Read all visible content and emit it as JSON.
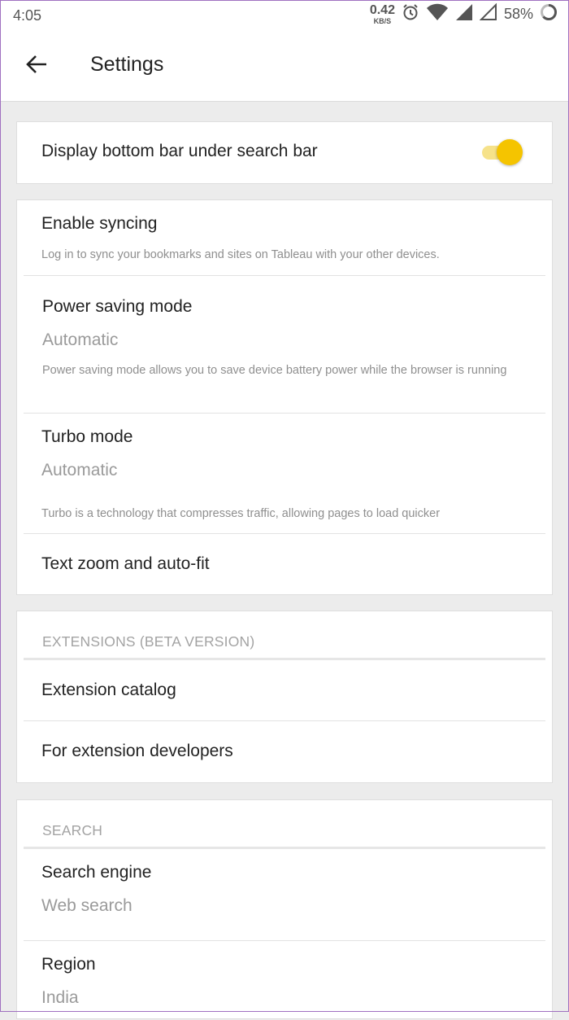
{
  "status_bar": {
    "time": "4:05",
    "speed_value": "0.42",
    "speed_unit": "KB/S",
    "battery": "58%"
  },
  "app_bar": {
    "title": "Settings"
  },
  "display_card": {
    "bottom_bar_label": "Display bottom bar under search bar",
    "bottom_bar_enabled": true
  },
  "general_card": {
    "syncing": {
      "title": "Enable syncing",
      "desc": "Log in to sync your bookmarks and sites on Tableau with your other devices."
    },
    "power": {
      "title": "Power saving mode",
      "value": "Automatic",
      "desc": "Power saving mode allows you to save device battery power while the browser is running"
    },
    "turbo": {
      "title": "Turbo mode",
      "value": "Automatic",
      "desc": "Turbo is a technology that compresses traffic, allowing pages to load quicker"
    },
    "text_zoom": {
      "title": "Text zoom and auto-fit"
    }
  },
  "extensions_card": {
    "header": "EXTENSIONS (BETA VERSION)",
    "catalog": "Extension catalog",
    "developers": "For extension developers"
  },
  "search_card": {
    "header": "SEARCH",
    "engine": {
      "title": "Search engine",
      "value": "Web search"
    },
    "region": {
      "title": "Region",
      "value": "India"
    }
  },
  "colors": {
    "accent": "#f5c400",
    "accent_track": "#f6e28a"
  }
}
